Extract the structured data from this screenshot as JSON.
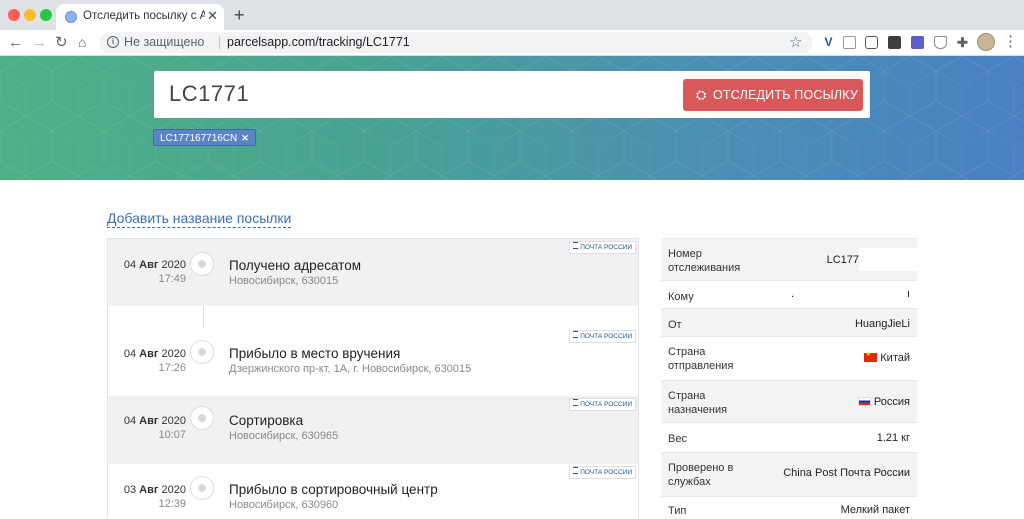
{
  "browser": {
    "tab_title": "Отследить посылку с Алиэкспресс",
    "tab_close_icon": "close-icon",
    "new_tab_icon": "plus-icon",
    "security_label": "Не защищено",
    "url": "parcelsapp.com/tracking/LC1771"
  },
  "hero": {
    "search_value": "LC1771",
    "track_button_label": "ОТСЛЕДИТЬ ПОСЫЛКУ",
    "chip_label": "LC177167716CN",
    "accent_color": "#d9595a"
  },
  "add_name_link": "Добавить название посылки",
  "carrier_badge": "ПОЧТА РОССИИ",
  "events": [
    {
      "day": "04",
      "month": "Авг",
      "year": "2020",
      "time": "17:49",
      "title": "Получено адресатом",
      "location": "Новосибирск, 630015"
    },
    {
      "day": "04",
      "month": "Авг",
      "year": "2020",
      "time": "17:26",
      "title": "Прибыло в место вручения",
      "location": "Дзержинского пр-кт, 1А, г. Новосибирск, 630015"
    },
    {
      "day": "04",
      "month": "Авг",
      "year": "2020",
      "time": "10:07",
      "title": "Сортировка",
      "location": "Новосибирск, 630965"
    },
    {
      "day": "03",
      "month": "Авг",
      "year": "2020",
      "time": "12:39",
      "title": "Прибыло в сортировочный центр",
      "location": "Новосибирск, 630960"
    }
  ],
  "details": {
    "tracking_label": "Номер отслеживания",
    "tracking_value": "LC177",
    "to_label": "Кому",
    "to_value_a": ".",
    "to_value_b": "ı",
    "from_label": "От",
    "from_value": "HuangJieLi",
    "origin_label": "Страна отправления",
    "origin_value": "Китай",
    "dest_label": "Страна назначения",
    "dest_value": "Россия",
    "weight_label": "Вес",
    "weight_value": "1.21 кг",
    "checked_label": "Проверено в службах",
    "checked_value_1": "China Post",
    "checked_value_2": "Почта России",
    "type_label": "Тип",
    "type_value": "Мелкий пакет"
  }
}
